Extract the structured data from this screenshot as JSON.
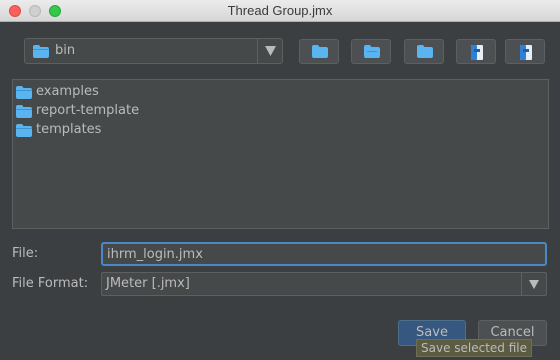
{
  "window": {
    "title": "Thread Group.jmx"
  },
  "location": {
    "current_folder": "bin"
  },
  "toolbar": {
    "buttons": [
      {
        "icon": "up-folder-icon"
      },
      {
        "icon": "home-folder-icon"
      },
      {
        "icon": "new-folder-icon"
      },
      {
        "icon": "list-view-icon"
      },
      {
        "icon": "details-view-icon"
      }
    ]
  },
  "files": [
    {
      "name": "examples",
      "icon": "folder-icon"
    },
    {
      "name": "report-template",
      "icon": "folder-icon"
    },
    {
      "name": "templates",
      "icon": "folder-icon"
    }
  ],
  "form": {
    "file_label": "File:",
    "file_value": "ihrm_login.jmx",
    "format_label": "File Format:",
    "format_value": "JMeter [.jmx]"
  },
  "buttons": {
    "save": "Save",
    "cancel": "Cancel"
  },
  "tooltip": "Save selected file",
  "colors": {
    "background": "#3c3f41",
    "panel": "#45494a",
    "accent": "#4a88c7",
    "folder": "#5ab4f0",
    "default_button": "#365880"
  }
}
